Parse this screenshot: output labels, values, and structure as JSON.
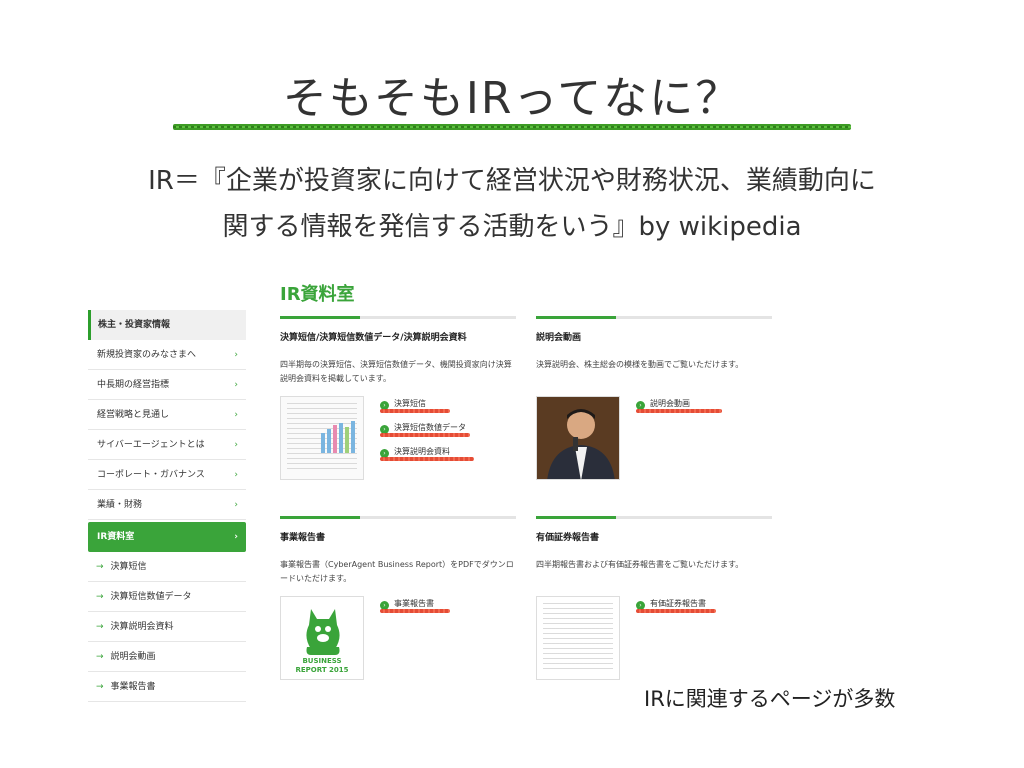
{
  "slide": {
    "title": "そもそもIRってなに？",
    "definition_line1": "IR＝『企業が投資家に向けて経営状況や財務状況、業績動向に",
    "definition_line2": "関する情報を発信する活動をいう』by wikipedia",
    "caption": "IRに関連するページが多数"
  },
  "sidebar": {
    "header": "株主・投資家情報",
    "items": [
      {
        "label": "新規投資家のみなさまへ",
        "arrow": "›"
      },
      {
        "label": "中長期の経営指標",
        "arrow": "›"
      },
      {
        "label": "経営戦略と見通し",
        "arrow": "›"
      },
      {
        "label": "サイバーエージェントとは",
        "arrow": "›"
      },
      {
        "label": "コーポレート・ガバナンス",
        "arrow": "›"
      },
      {
        "label": "業績・財務",
        "arrow": "›"
      }
    ],
    "active": {
      "label": "IR資料室",
      "arrow": "›"
    },
    "subitems": [
      {
        "arrow": "→",
        "label": "決算短信"
      },
      {
        "arrow": "→",
        "label": "決算短信数値データ"
      },
      {
        "arrow": "→",
        "label": "決算説明会資料"
      },
      {
        "arrow": "→",
        "label": "説明会動画"
      },
      {
        "arrow": "→",
        "label": "事業報告書"
      }
    ]
  },
  "main": {
    "heading": "IR資料室",
    "cards": [
      {
        "title": "決算短信/決算短信数値データ/決算説明会資料",
        "desc": "四半期毎の決算短信、決算短信数値データ、機関投資家向け決算説明会資料を掲載しています。",
        "links": [
          "決算短信",
          "決算短信数値データ",
          "決算説明会資料"
        ]
      },
      {
        "title": "説明会動画",
        "desc": "決算説明会、株主総会の模様を動画でご覧いただけます。",
        "links": [
          "説明会動画"
        ]
      },
      {
        "title": "事業報告書",
        "desc": "事業報告書（CyberAgent Business Report）をPDFでダウンロードいただけます。",
        "links": [
          "事業報告書"
        ],
        "thumb_line1": "BUSINESS",
        "thumb_line2": "REPORT 2015"
      },
      {
        "title": "有価証券報告書",
        "desc": "四半期報告書および有価証券報告書をご覧いただけます。",
        "links": [
          "有価証券報告書"
        ]
      }
    ]
  },
  "colors": {
    "accent_green": "#3aa43a",
    "underline_red": "#e2381f",
    "title_underline": "#3d9b25"
  }
}
